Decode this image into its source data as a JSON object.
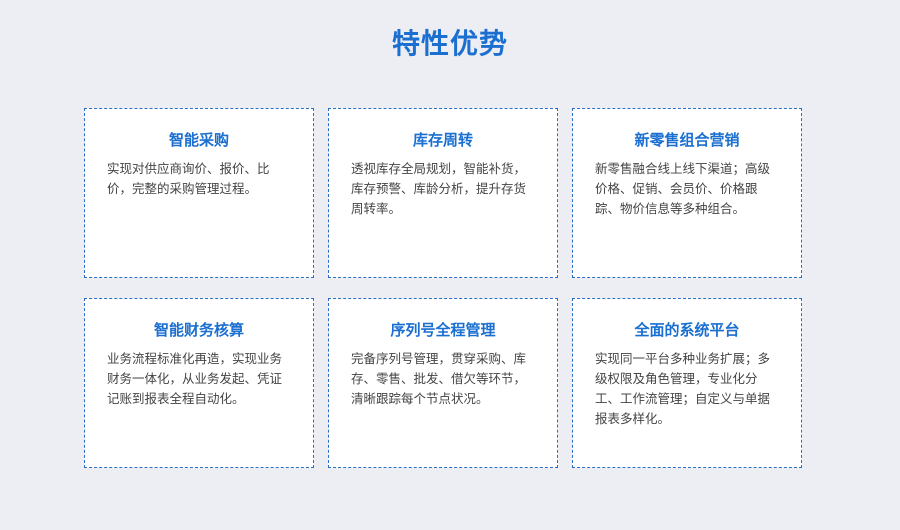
{
  "page": {
    "title": "特性优势"
  },
  "cards": [
    {
      "title": "智能采购",
      "desc": "实现对供应商询价、报价、比价，完整的采购管理过程。"
    },
    {
      "title": "库存周转",
      "desc": "透视库存全局规划，智能补货，库存预警、库龄分析，提升存货周转率。"
    },
    {
      "title": "新零售组合营销",
      "desc": "新零售融合线上线下渠道；高级价格、促销、会员价、价格跟踪、物价信息等多种组合。"
    },
    {
      "title": "智能财务核算",
      "desc": "业务流程标准化再造，实现业务财务一体化，从业务发起、凭证记账到报表全程自动化。"
    },
    {
      "title": "序列号全程管理",
      "desc": "完备序列号管理，贯穿采购、库存、零售、批发、借欠等环节，清晰跟踪每个节点状况。"
    },
    {
      "title": "全面的系统平台",
      "desc": "实现同一平台多种业务扩展；多级权限及角色管理，专业化分工、工作流管理；自定义与单据报表多样化。"
    }
  ],
  "colors": {
    "accent": "#1a6fd0",
    "background": "#eceef3",
    "card_border": "#2a6fc4"
  }
}
